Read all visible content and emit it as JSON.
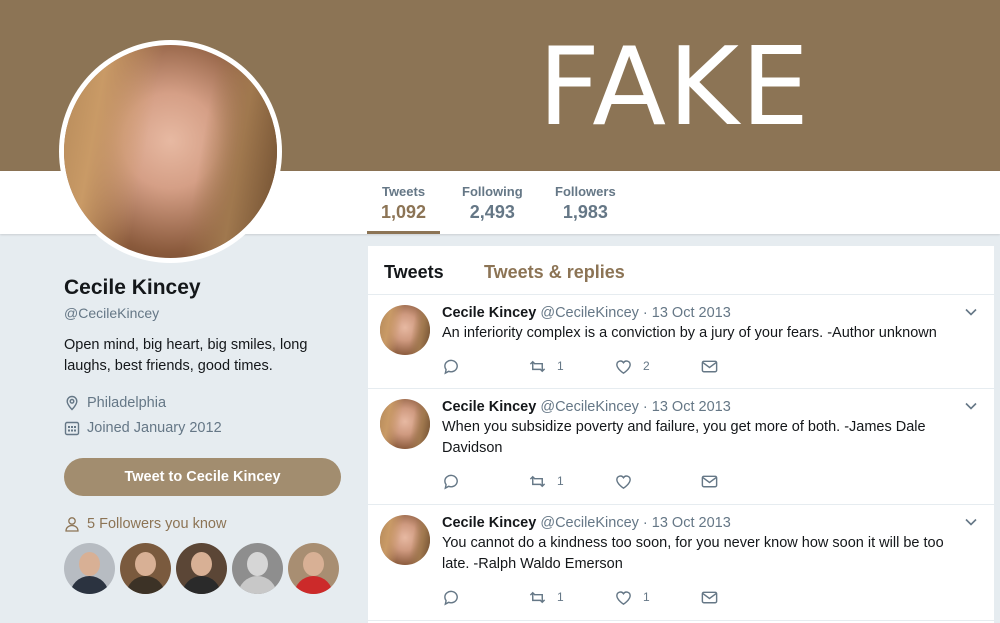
{
  "banner": {
    "text": "FAKE",
    "color": "#8c7455"
  },
  "nav": {
    "stats": [
      {
        "label": "Tweets",
        "value": "1,092",
        "active": true
      },
      {
        "label": "Following",
        "value": "2,493"
      },
      {
        "label": "Followers",
        "value": "1,983"
      }
    ]
  },
  "profile": {
    "name": "Cecile Kincey",
    "handle": "@CecileKincey",
    "bio": "Open mind, big heart, big smiles, long laughs, best friends, good times.",
    "location": "Philadelphia",
    "joined": "Joined January 2012",
    "tweet_to_label": "Tweet to Cecile Kincey",
    "followers_you_know": "5 Followers you know",
    "followers_avatars": [
      {
        "shirt": "#2b3340"
      },
      {
        "shirt": "#3c3226"
      },
      {
        "shirt": "#2a2a2a"
      },
      {
        "shirt": "#c8c8c8"
      },
      {
        "shirt": "#cc2a2a"
      }
    ]
  },
  "timeline": {
    "tabs": [
      {
        "label": "Tweets"
      },
      {
        "label": "Tweets & replies"
      }
    ],
    "tweets": [
      {
        "name": "Cecile Kincey",
        "handle": "@CecileKincey",
        "date": "· 13 Oct 2013",
        "text": "An inferiority complex is a conviction by a jury of your fears. -Author unknown",
        "retweets": "1",
        "likes": "2"
      },
      {
        "name": "Cecile Kincey",
        "handle": "@CecileKincey",
        "date": "· 13 Oct 2013",
        "text": "When you subsidize poverty and failure, you get more of both. -James Dale Davidson",
        "retweets": "1",
        "likes": ""
      },
      {
        "name": "Cecile Kincey",
        "handle": "@CecileKincey",
        "date": "· 13 Oct 2013",
        "text": "You cannot do a kindness too soon, for you never know how soon it will be too late. -Ralph Waldo Emerson",
        "retweets": "1",
        "likes": "1"
      }
    ]
  },
  "colors": {
    "accent": "#8c7455",
    "button": "#a28d6f",
    "muted": "#657786"
  }
}
